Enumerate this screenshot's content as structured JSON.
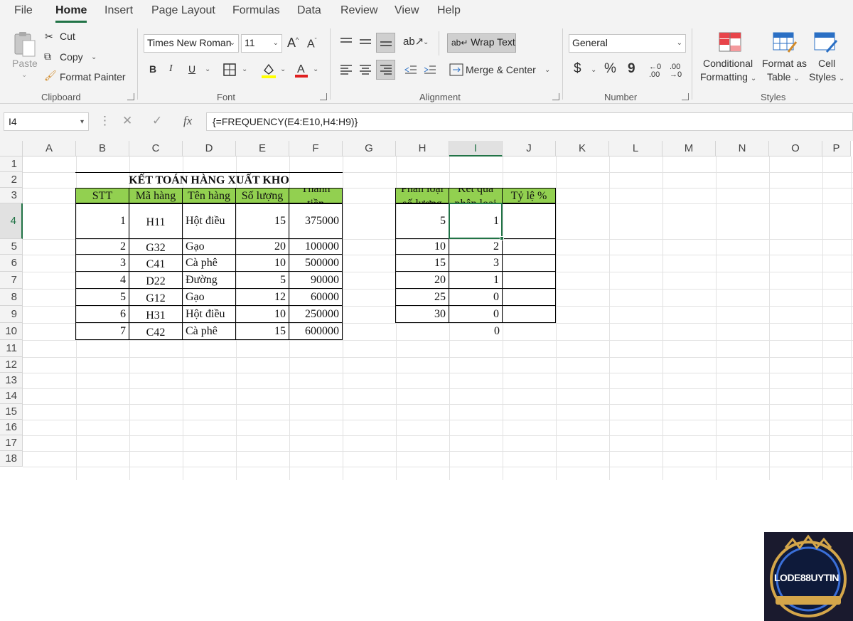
{
  "menu": [
    "File",
    "Home",
    "Insert",
    "Page Layout",
    "Formulas",
    "Data",
    "Review",
    "View",
    "Help"
  ],
  "ribbon": {
    "clipboard": {
      "paste": "Paste",
      "cut": "Cut",
      "copy": "Copy",
      "format_painter": "Format Painter",
      "label": "Clipboard"
    },
    "font": {
      "name": "Times New Roman",
      "size": "11",
      "bold": "B",
      "italic": "I",
      "underline": "U",
      "label": "Font"
    },
    "alignment": {
      "wrap_text": "Wrap Text",
      "merge_center": "Merge & Center",
      "label": "Alignment"
    },
    "number": {
      "format": "General",
      "currency": "$",
      "percent": "%",
      "comma": "9",
      "label": "Number"
    },
    "styles": {
      "conditional": "Conditional",
      "conditional2": "Formatting",
      "format_table": "Format as",
      "format_table2": "Table",
      "cell_styles": "Cell",
      "cell_styles2": "Styles",
      "label": "Styles"
    }
  },
  "formula_bar": {
    "name_box": "I4",
    "formula": "{=FREQUENCY(E4:E10,H4:H9)}",
    "fx": "fx"
  },
  "columns": [
    "A",
    "B",
    "C",
    "D",
    "E",
    "F",
    "G",
    "H",
    "I",
    "J",
    "K",
    "L",
    "M",
    "N",
    "O",
    "P"
  ],
  "rows": [
    "1",
    "2",
    "3",
    "4",
    "5",
    "6",
    "7",
    "8",
    "9",
    "10",
    "11",
    "12",
    "13",
    "14",
    "15",
    "16",
    "17",
    "18"
  ],
  "table1": {
    "title": "KẾT TOÁN HÀNG XUẤT KHO",
    "headers": [
      "STT",
      "Mã hàng",
      "Tên hàng",
      "Số lượng",
      "Thành tiền"
    ],
    "rows": [
      [
        "1",
        "H11",
        "Hột điều",
        "15",
        "375000"
      ],
      [
        "2",
        "G32",
        "Gạo",
        "20",
        "100000"
      ],
      [
        "3",
        "C41",
        "Cà phê",
        "10",
        "500000"
      ],
      [
        "4",
        "D22",
        "Đường",
        "5",
        "90000"
      ],
      [
        "5",
        "G12",
        "Gạo",
        "12",
        "60000"
      ],
      [
        "6",
        "H31",
        "Hột điều",
        "10",
        "250000"
      ],
      [
        "7",
        "C42",
        "Cà phê",
        "15",
        "600000"
      ]
    ]
  },
  "table2": {
    "headers": [
      "Phân loại số lượng",
      "Kết quả phân loại",
      "Tỷ lệ %"
    ],
    "rows": [
      [
        "5",
        "1"
      ],
      [
        "10",
        "2"
      ],
      [
        "15",
        "3"
      ],
      [
        "20",
        "1"
      ],
      [
        "25",
        "0"
      ],
      [
        "30",
        "0"
      ]
    ],
    "overflow": "0"
  },
  "logo": {
    "text": "LODE88UYTIN"
  },
  "colors": {
    "accent": "#217346",
    "header_fill": "#92d050"
  }
}
